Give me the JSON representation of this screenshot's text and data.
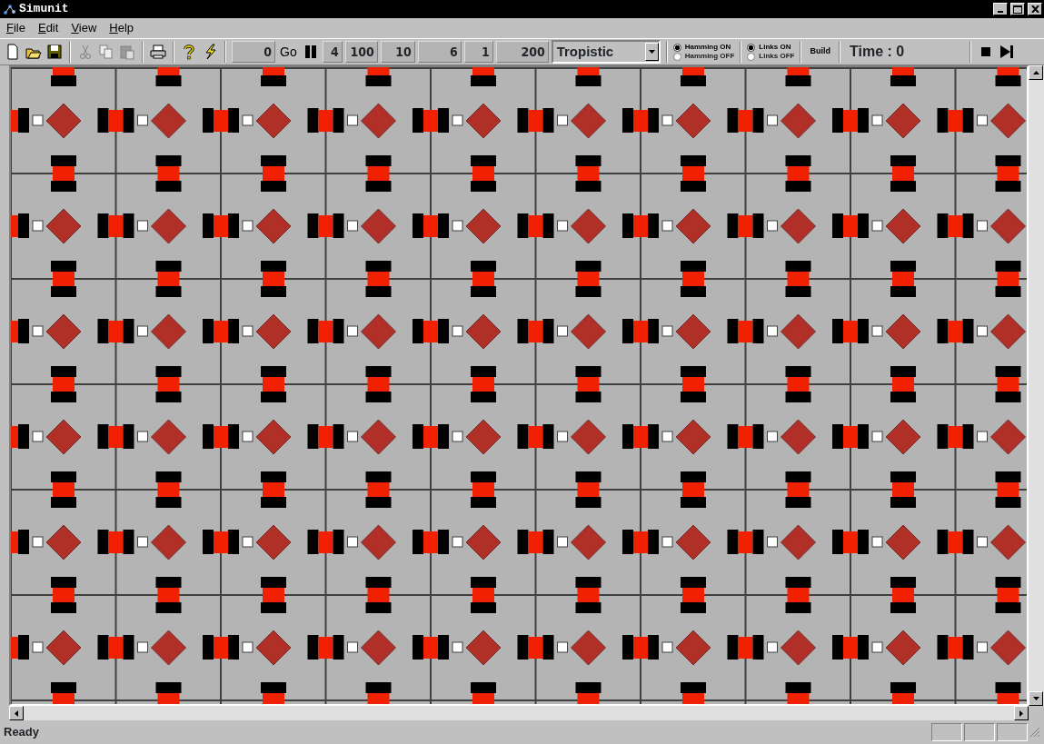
{
  "window": {
    "title": "Simunit"
  },
  "menu": [
    {
      "label": "File"
    },
    {
      "label": "Edit"
    },
    {
      "label": "View"
    },
    {
      "label": "Help"
    }
  ],
  "toolbar": {
    "start_field": "0",
    "go_button": "Go",
    "fields": [
      "4",
      "100",
      "10",
      "6",
      "1",
      "200"
    ],
    "mode_combo": "Tropistic",
    "radio_groups": [
      [
        {
          "label": "Hamming ON",
          "selected": true
        },
        {
          "label": "Hamming OFF",
          "selected": false
        }
      ],
      [
        {
          "label": "Links ON",
          "selected": true
        },
        {
          "label": "Links OFF",
          "selected": false
        }
      ]
    ],
    "build_button": "Build",
    "time": "Time : 0"
  },
  "status_bar": {
    "text": "Ready"
  }
}
